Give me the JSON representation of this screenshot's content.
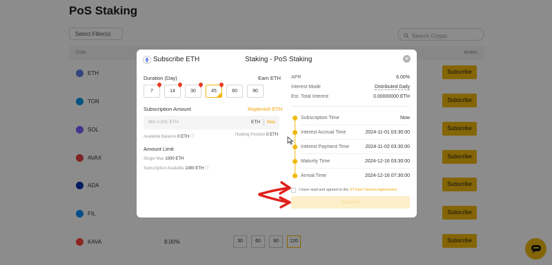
{
  "page": {
    "title": "PoS Staking",
    "filter_label": "Select Filter(s)",
    "search_placeholder": "Search Crypto",
    "columns": {
      "coin": "Coin",
      "action": "Action"
    },
    "rows": [
      {
        "coin": "ETH",
        "color": "#627eea",
        "apr": "",
        "action": "Subscribe"
      },
      {
        "coin": "TON",
        "color": "#0098ea",
        "apr": "",
        "action": "Subscribe"
      },
      {
        "coin": "SOL",
        "color": "#7b61ff",
        "apr": "",
        "action": "Subscribe"
      },
      {
        "coin": "AVAX",
        "color": "#e84142",
        "apr": "",
        "action": "Subscribe"
      },
      {
        "coin": "ADA",
        "color": "#0033ad",
        "apr": "",
        "action": "Subscribe"
      },
      {
        "coin": "FIL",
        "color": "#0090ff",
        "apr": "",
        "action": "Subscribe"
      },
      {
        "coin": "KAVA",
        "color": "#ff433e",
        "apr": "8.00%",
        "action": "Subscribe",
        "durations": [
          "30",
          "60",
          "90",
          "120"
        ]
      }
    ]
  },
  "modal": {
    "title": "Subscribe ETH",
    "header_center": "Staking - PoS Staking",
    "duration_label": "Duration (Day)",
    "earn_label": "Earn ETH",
    "durations": [
      "7",
      "14",
      "30",
      "45",
      "60",
      "90"
    ],
    "selected_duration": "45",
    "subscription_amount_label": "Subscription Amount",
    "replenish_label": "Replenish ETH",
    "amount_placeholder": "Min 0.001 ETH",
    "amount_unit": "ETH",
    "max_label": "Max",
    "available_balance_label": "Available Balance",
    "available_balance_value": "0 ETH",
    "holding_position_label": "Holding Position",
    "holding_position_value": "0 ETH",
    "amount_limit_label": "Amount Limit",
    "single_max_label": "Single Max",
    "single_max_value": "1000 ETH",
    "subscription_available_label": "Subscription Available",
    "subscription_available_value": "1000 ETH",
    "apr_label": "APR",
    "apr_value": "6.00%",
    "interest_mode_label": "Interest Mode",
    "interest_mode_value": "Distributed Daily",
    "total_interest_label": "Est. Total Interest",
    "total_interest_value": "0.00000000 ETH",
    "timeline": [
      {
        "label": "Subscription Time",
        "value": "Now"
      },
      {
        "label": "Interest Accrual Time",
        "value": "2024-11-01 03:30:00"
      },
      {
        "label": "Interest Payment Time",
        "value": "2024-11-02 03:30:00"
      },
      {
        "label": "Maturity Time",
        "value": "2024-12-16 03:30:00"
      },
      {
        "label": "Arrival Time",
        "value": "2024-12-16 07:30:00"
      }
    ],
    "agreement_text": "I have read and agreed to the",
    "agreement_link": "XT Earn Service Agreement",
    "confirm_label": "Confirm"
  },
  "colors": {
    "accent": "#f0b90b",
    "annotation_arrow": "#e0201b"
  }
}
